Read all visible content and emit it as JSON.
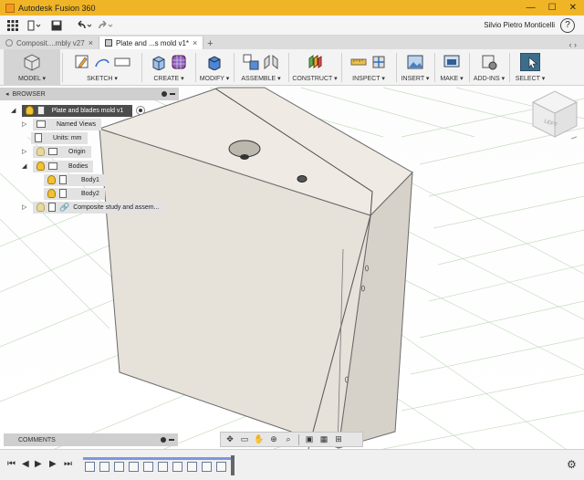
{
  "window": {
    "title": "Autodesk Fusion 360",
    "controls": [
      "—",
      "☐",
      "✕"
    ]
  },
  "quick_access": {
    "user_name": "Silvio Pietro Monticelli",
    "help": "?"
  },
  "tabs": [
    {
      "label": "Composit....mbly v27",
      "active": false
    },
    {
      "label": "Plate and ...s mold v1*",
      "active": true
    }
  ],
  "toolbar": {
    "groups": [
      {
        "label": "MODEL ▾"
      },
      {
        "label": "SKETCH ▾"
      },
      {
        "label": "CREATE ▾"
      },
      {
        "label": "MODIFY ▾"
      },
      {
        "label": "ASSEMBLE ▾"
      },
      {
        "label": "CONSTRUCT ▾"
      },
      {
        "label": "INSPECT ▾"
      },
      {
        "label": "INSERT ▾"
      },
      {
        "label": "MAKE ▾"
      },
      {
        "label": "ADD-INS ▾"
      },
      {
        "label": "SELECT ▾"
      }
    ]
  },
  "browser": {
    "header": "BROWSER",
    "root": "Plate and blades mold v1",
    "items": [
      {
        "label": "Named Views"
      },
      {
        "label": "Units: mm"
      },
      {
        "label": "Origin"
      },
      {
        "label": "Bodies"
      },
      {
        "label": "Body1"
      },
      {
        "label": "Body2"
      },
      {
        "label": "Composite study and assem..."
      }
    ]
  },
  "viewcube": {
    "face_label": "LEFT"
  },
  "comments": {
    "header": "COMMENTS"
  },
  "colors": {
    "title_bar": "#f0b526",
    "body_face_front": "#e6e1d9",
    "body_face_top": "#efebe4",
    "body_face_side": "#d7d2c9",
    "timeline_bar": "#7f96e0",
    "grid": "#b9d3b2"
  }
}
